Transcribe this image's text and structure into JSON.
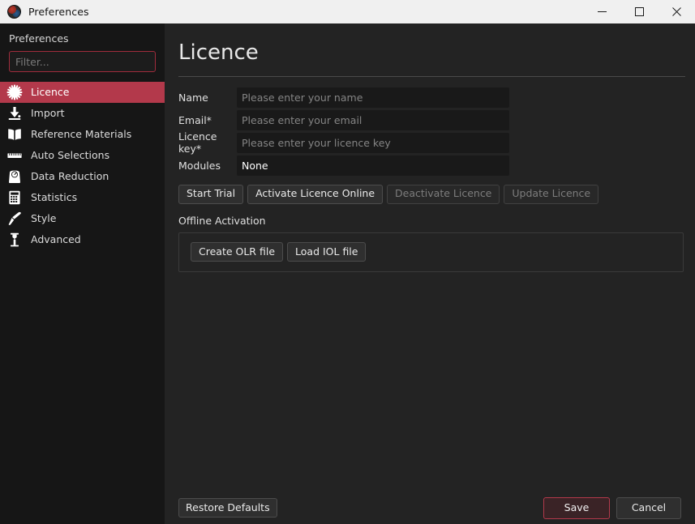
{
  "window": {
    "title": "Preferences",
    "icon": "app-icon",
    "controls": {
      "minimize": "minimize-icon",
      "maximize": "maximize-icon",
      "close": "close-icon"
    }
  },
  "sidebar": {
    "heading": "Preferences",
    "filter": {
      "value": "",
      "placeholder": "Filter..."
    },
    "items": [
      {
        "label": "Licence",
        "icon": "gear-sunburst-icon",
        "active": true
      },
      {
        "label": "Import",
        "icon": "download-icon",
        "active": false
      },
      {
        "label": "Reference Materials",
        "icon": "book-icon",
        "active": false
      },
      {
        "label": "Auto Selections",
        "icon": "ruler-icon",
        "active": false
      },
      {
        "label": "Data Reduction",
        "icon": "scale-icon",
        "active": false
      },
      {
        "label": "Statistics",
        "icon": "calculator-icon",
        "active": false
      },
      {
        "label": "Style",
        "icon": "paintbrush-icon",
        "active": false
      },
      {
        "label": "Advanced",
        "icon": "flask-icon",
        "active": false
      }
    ]
  },
  "main": {
    "title": "Licence",
    "fields": {
      "name": {
        "label": "Name",
        "value": "",
        "placeholder": "Please enter your name"
      },
      "email": {
        "label": "Email*",
        "value": "",
        "placeholder": "Please enter your email"
      },
      "licence_key": {
        "label": "Licence key*",
        "value": "",
        "placeholder": "Please enter your licence key"
      },
      "modules": {
        "label": "Modules",
        "value": "None"
      }
    },
    "actions": [
      {
        "label": "Start Trial",
        "disabled": false
      },
      {
        "label": "Activate Licence Online",
        "disabled": false
      },
      {
        "label": "Deactivate Licence",
        "disabled": true
      },
      {
        "label": "Update Licence",
        "disabled": true
      }
    ],
    "offline": {
      "section_label": "Offline Activation",
      "create_button": "Create OLR file",
      "load_button": "Load IOL file"
    }
  },
  "footer": {
    "restore_defaults": "Restore Defaults",
    "save": "Save",
    "cancel": "Cancel"
  },
  "colors": {
    "accent": "#b3394b",
    "titlebar_bg": "#f0f0f0",
    "sidebar_bg": "#161616",
    "content_bg": "#232323",
    "input_bg": "#191919"
  }
}
